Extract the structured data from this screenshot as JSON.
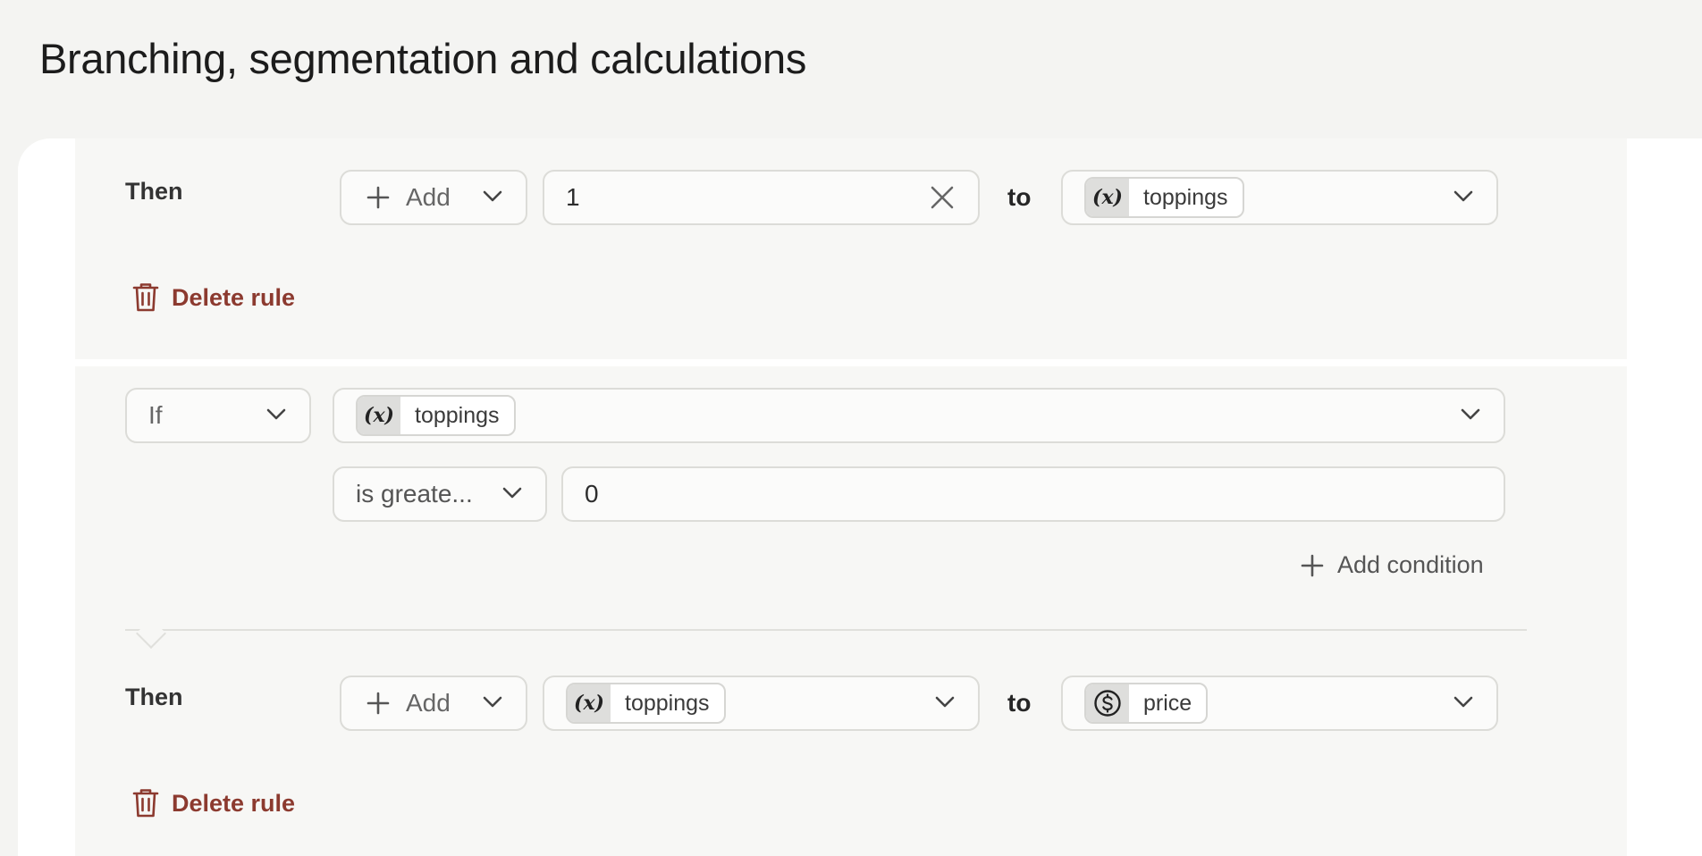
{
  "page_title": "Branching, segmentation and calculations",
  "rule1": {
    "then_label": "Then",
    "action": {
      "label": "Add"
    },
    "value": "1",
    "to_label": "to",
    "target": {
      "icon": "variable-icon",
      "icon_text": "(x)",
      "label": "toppings"
    },
    "delete_label": "Delete rule"
  },
  "rule2": {
    "if_label": "If",
    "condition_variable": {
      "icon": "variable-icon",
      "icon_text": "(x)",
      "label": "toppings"
    },
    "operator": "is greate...",
    "compare_value": "0",
    "add_condition_label": "Add condition",
    "then_label": "Then",
    "action": {
      "label": "Add"
    },
    "source": {
      "icon": "variable-icon",
      "icon_text": "(x)",
      "label": "toppings"
    },
    "to_label": "to",
    "target": {
      "icon": "dollar-icon",
      "label": "price"
    },
    "delete_label": "Delete rule"
  },
  "colors": {
    "background": "#f4f4f2",
    "panel": "#ffffff",
    "rule_bg": "#f7f7f5",
    "delete_red": "#8c3a2f",
    "border": "#dcdcd8"
  }
}
